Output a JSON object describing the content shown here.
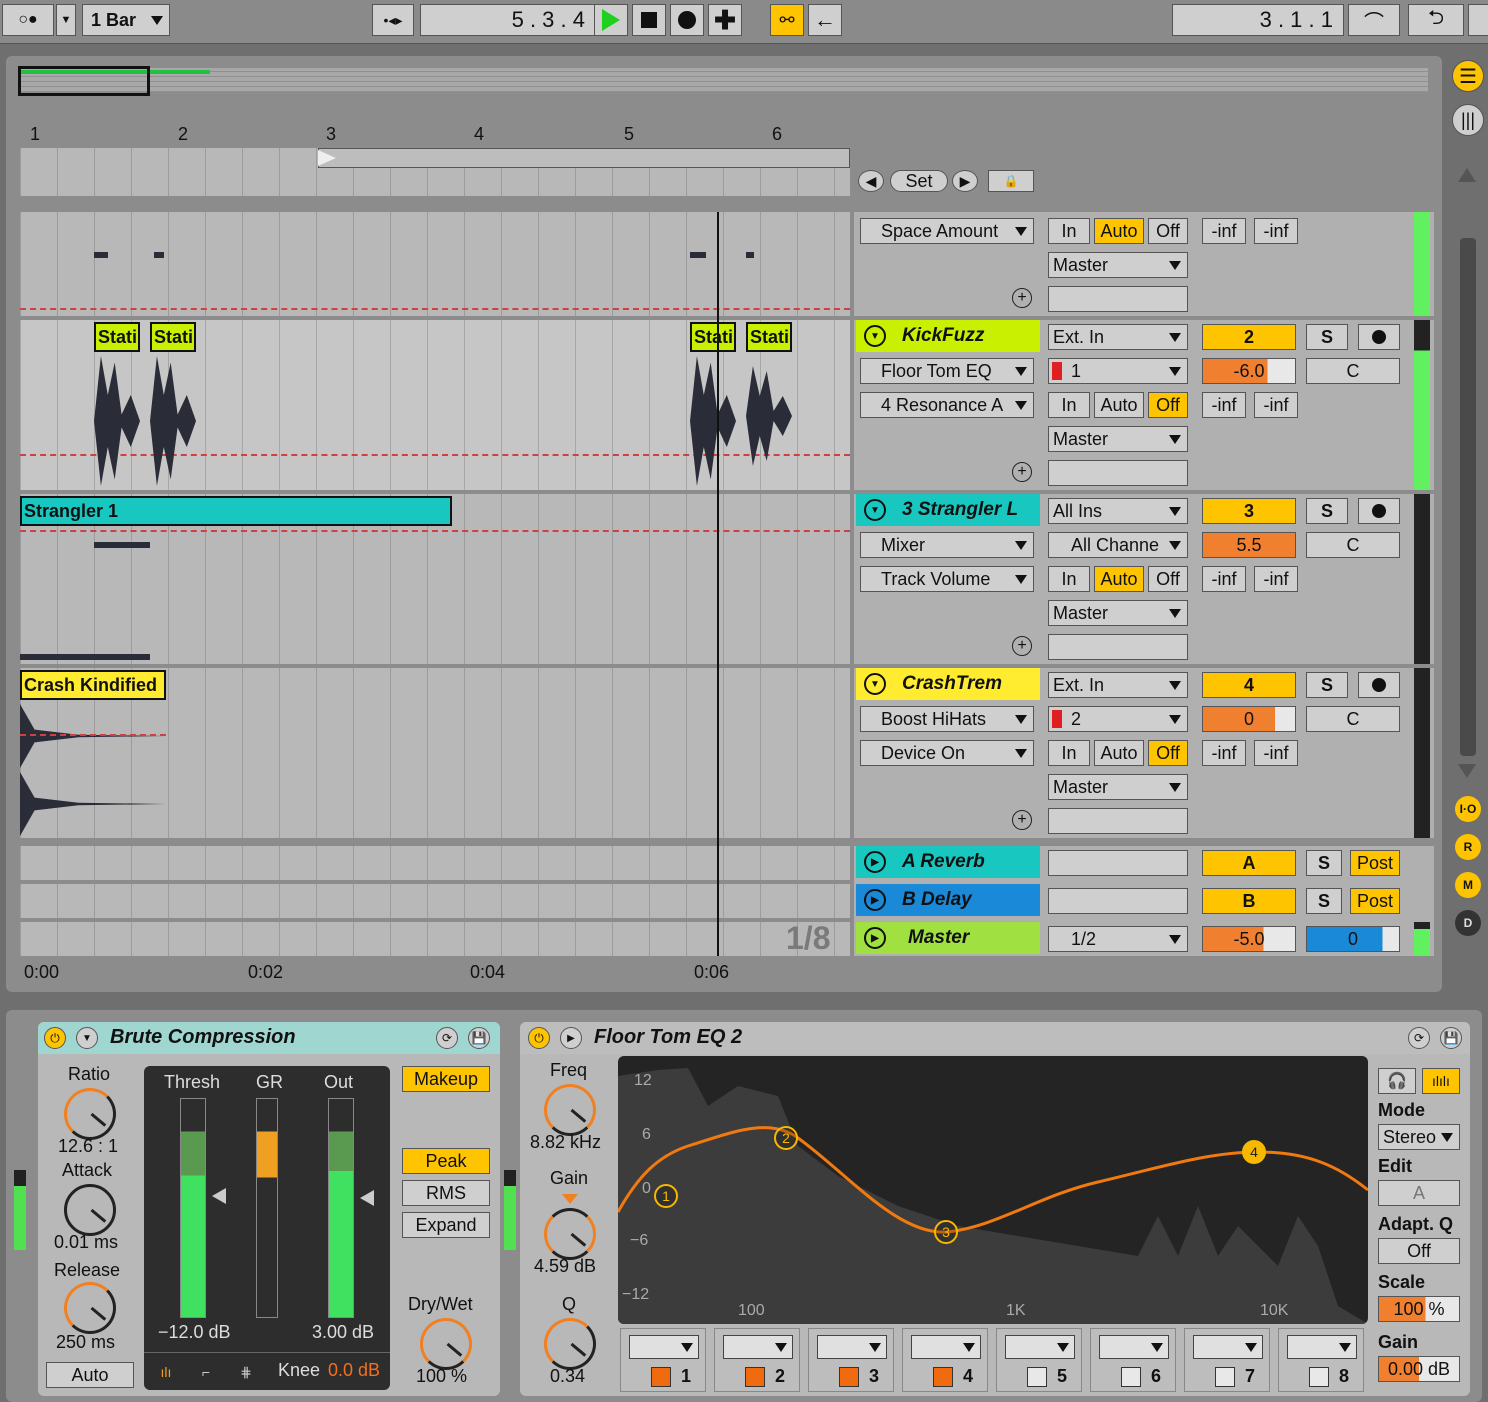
{
  "transport": {
    "quant": "1 Bar",
    "position": "5 .   3 .   4",
    "loop_pos": "3 .   1 .   1"
  },
  "arrangement": {
    "bar_numbers": [
      "1",
      "2",
      "3",
      "4",
      "5",
      "6"
    ],
    "time_labels": [
      "0:00",
      "0:02",
      "0:04",
      "0:06"
    ],
    "grid_label": "1/8",
    "set_label": "Set"
  },
  "tracks": [
    {
      "id": "t0",
      "param": "Space Amount",
      "mon": [
        "In",
        "Auto",
        "Off"
      ],
      "mon_active": "Auto",
      "out": "Master",
      "vols": [
        "-inf",
        "-inf"
      ]
    },
    {
      "id": "t1",
      "name": "KickFuzz",
      "color": "#c8f000",
      "clips": [
        "Stati",
        "Stati",
        "Stati",
        "Stati"
      ],
      "device": "Floor Tom EQ",
      "param": "4 Resonance A",
      "input": "Ext. In",
      "channel": "1",
      "mon": [
        "In",
        "Auto",
        "Off"
      ],
      "mon_active": "Off",
      "out": "Master",
      "track_num": "2",
      "volume": "-6.0",
      "pan": "C",
      "vols": [
        "-inf",
        "-inf"
      ],
      "solo": "S"
    },
    {
      "id": "t2",
      "name": "3 Strangler L",
      "color": "#18c8c0",
      "clips": [
        "Strangler 1"
      ],
      "device": "Mixer",
      "param": "Track Volume",
      "input": "All Ins",
      "channel": "All Channe",
      "mon": [
        "In",
        "Auto",
        "Off"
      ],
      "mon_active": "Auto",
      "out": "Master",
      "track_num": "3",
      "volume": "5.5",
      "pan": "C",
      "vols": [
        "-inf",
        "-inf"
      ],
      "solo": "S"
    },
    {
      "id": "t3",
      "name": "CrashTrem",
      "color": "#ffec30",
      "clips": [
        "Crash Kindified"
      ],
      "device": "Boost HiHats",
      "param": "Device On",
      "input": "Ext. In",
      "channel": "2",
      "mon": [
        "In",
        "Auto",
        "Off"
      ],
      "mon_active": "Off",
      "out": "Master",
      "track_num": "4",
      "volume": "0",
      "pan": "C",
      "vols": [
        "-inf",
        "-inf"
      ],
      "solo": "S"
    }
  ],
  "returns": [
    {
      "name": "A Reverb",
      "color": "#18c8c0",
      "letter": "A",
      "solo": "S",
      "post": "Post"
    },
    {
      "name": "B Delay",
      "color": "#1a8ad8",
      "letter": "B",
      "solo": "S",
      "post": "Post"
    }
  ],
  "master": {
    "name": "Master",
    "color": "#a0e040",
    "cue": "1/2",
    "volume": "-5.0",
    "cue_vol": "0"
  },
  "side": {
    "io": "I·O",
    "r": "R",
    "m": "M",
    "d": "D"
  },
  "compressor": {
    "title": "Brute Compression",
    "ratio_label": "Ratio",
    "ratio": "12.6 : 1",
    "attack_label": "Attack",
    "attack": "0.01 ms",
    "release_label": "Release",
    "release": "250 ms",
    "auto": "Auto",
    "thresh_label": "Thresh",
    "gr_label": "GR",
    "out_label": "Out",
    "thresh": "−12.0 dB",
    "out": "3.00 dB",
    "knee_label": "Knee",
    "knee": "0.0 dB",
    "makeup": "Makeup",
    "peak": "Peak",
    "rms": "RMS",
    "expand": "Expand",
    "drywet_label": "Dry/Wet",
    "drywet": "100 %"
  },
  "eq": {
    "title": "Floor Tom EQ 2",
    "freq_label": "Freq",
    "freq": "8.82 kHz",
    "gain_label": "Gain",
    "gain": "4.59 dB",
    "q_label": "Q",
    "q": "0.34",
    "db_ticks": [
      "12",
      "6",
      "0",
      "−6",
      "−12"
    ],
    "freq_ticks": [
      "100",
      "1K",
      "10K"
    ],
    "bands": [
      "1",
      "2",
      "3",
      "4",
      "5",
      "6",
      "7",
      "8"
    ],
    "band_on": [
      true,
      true,
      true,
      true,
      false,
      false,
      false,
      false
    ],
    "mode_label": "Mode",
    "mode": "Stereo",
    "edit_label": "Edit",
    "edit": "A",
    "adaptq_label": "Adapt. Q",
    "adaptq": "Off",
    "scale_label": "Scale",
    "scale": "100 %",
    "gain2_label": "Gain",
    "gain2": "0.00 dB"
  }
}
